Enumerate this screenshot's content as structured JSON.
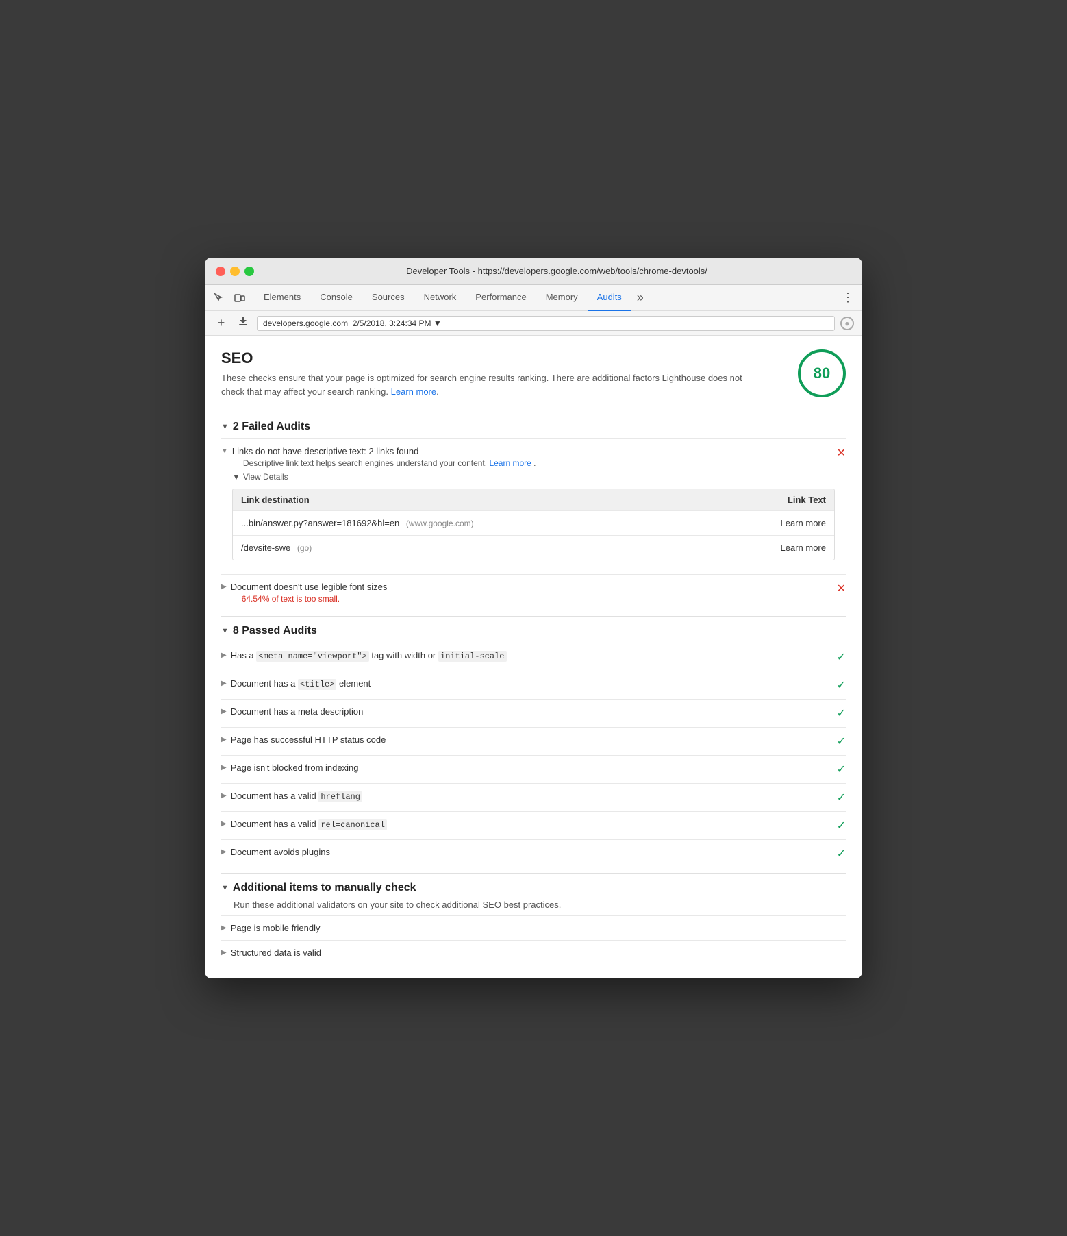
{
  "window": {
    "title": "Developer Tools - https://developers.google.com/web/tools/chrome-devtools/"
  },
  "tabs": [
    {
      "id": "elements",
      "label": "Elements",
      "active": false
    },
    {
      "id": "console",
      "label": "Console",
      "active": false
    },
    {
      "id": "sources",
      "label": "Sources",
      "active": false
    },
    {
      "id": "network",
      "label": "Network",
      "active": false
    },
    {
      "id": "performance",
      "label": "Performance",
      "active": false
    },
    {
      "id": "memory",
      "label": "Memory",
      "active": false
    },
    {
      "id": "audits",
      "label": "Audits",
      "active": true
    }
  ],
  "url_bar": {
    "value": "developers.google.com  2/5/2018, 3:24:34 PM ▼"
  },
  "seo": {
    "title": "SEO",
    "description": "These checks ensure that your page is optimized for search engine results ranking. There are additional factors Lighthouse does not check that may affect your search ranking.",
    "learn_more": "Learn more",
    "score": "80",
    "failed_section_title": "2 Failed Audits",
    "passed_section_title": "8 Passed Audits",
    "manual_section_title": "Additional items to manually check",
    "manual_section_desc": "Run these additional validators on your site to check additional SEO best practices."
  },
  "failed_audits": [
    {
      "id": "links-descriptive-text",
      "title": "Links do not have descriptive text: 2 links found",
      "subtitle": "Descriptive link text helps search engines understand your content.",
      "subtitle_link": "Learn more",
      "fail_text": null,
      "expanded": true,
      "view_details": true,
      "table": {
        "col1": "Link destination",
        "col2": "Link Text",
        "rows": [
          {
            "dest": "...bin/answer.py?answer=181692&hl=en",
            "domain": "(www.google.com)",
            "text": "Learn more"
          },
          {
            "dest": "/devsite-swe",
            "domain": "(go)",
            "text": "Learn more"
          }
        ]
      }
    },
    {
      "id": "font-sizes",
      "title": "Document doesn't use legible font sizes",
      "subtitle": null,
      "fail_text": "64.54% of text is too small.",
      "expanded": false,
      "view_details": false
    }
  ],
  "passed_audits": [
    {
      "id": "viewport",
      "title_plain": "Has a ",
      "title_code": "<meta name=\"viewport\">",
      "title_after": " tag with width or ",
      "title_code2": "initial-scale"
    },
    {
      "id": "title",
      "title_plain": "Document has a ",
      "title_code": "<title>",
      "title_after": " element",
      "title_code2": null
    },
    {
      "id": "meta-desc",
      "title_plain": "Document has a meta description",
      "title_code": null,
      "title_after": null,
      "title_code2": null
    },
    {
      "id": "http-status",
      "title_plain": "Page has successful HTTP status code",
      "title_code": null,
      "title_after": null,
      "title_code2": null
    },
    {
      "id": "indexing",
      "title_plain": "Page isn't blocked from indexing",
      "title_code": null,
      "title_after": null,
      "title_code2": null
    },
    {
      "id": "hreflang",
      "title_plain": "Document has a valid ",
      "title_code": "hreflang",
      "title_after": null,
      "title_code2": null
    },
    {
      "id": "canonical",
      "title_plain": "Document has a valid ",
      "title_code": "rel=canonical",
      "title_after": null,
      "title_code2": null
    },
    {
      "id": "plugins",
      "title_plain": "Document avoids plugins",
      "title_code": null,
      "title_after": null,
      "title_code2": null
    }
  ],
  "manual_audits": [
    {
      "id": "mobile-friendly",
      "title": "Page is mobile friendly"
    },
    {
      "id": "structured-data",
      "title": "Structured data is valid"
    }
  ]
}
